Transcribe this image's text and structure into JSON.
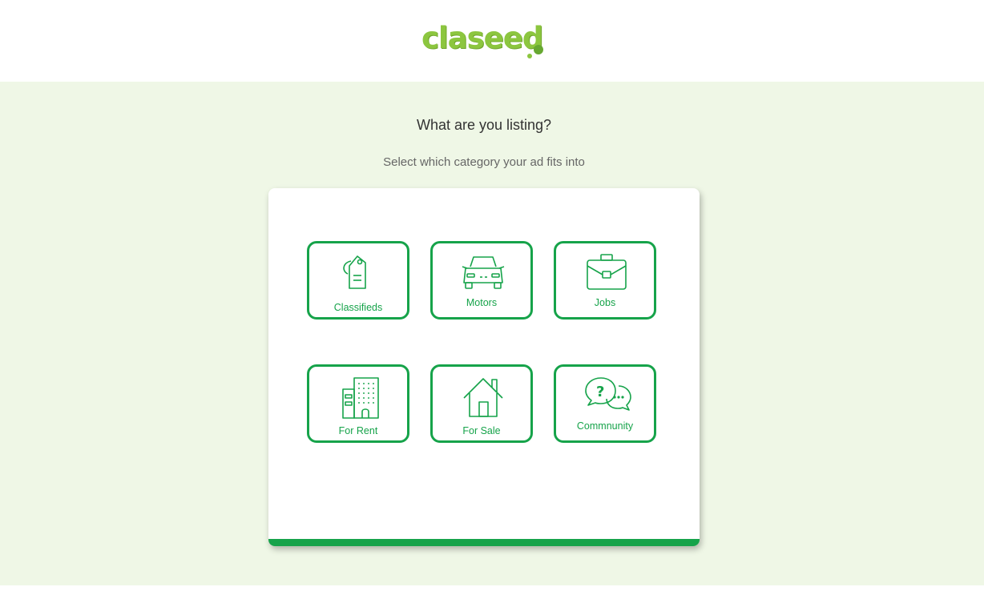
{
  "brand": {
    "name": "claseed",
    "color": "#8cc63f"
  },
  "page": {
    "title": "What are you listing?",
    "subtitle": "Select which category your ad fits into"
  },
  "categories": [
    {
      "label": "Classifieds",
      "icon": "price-tag-icon"
    },
    {
      "label": "Motors",
      "icon": "car-icon"
    },
    {
      "label": "Jobs",
      "icon": "briefcase-icon"
    },
    {
      "label": "For Rent",
      "icon": "building-icon"
    },
    {
      "label": "For Sale",
      "icon": "house-icon"
    },
    {
      "label": "Commnunity",
      "icon": "chat-bubbles-icon"
    }
  ],
  "colors": {
    "accent": "#16a34a",
    "background": "#eff7e6"
  }
}
